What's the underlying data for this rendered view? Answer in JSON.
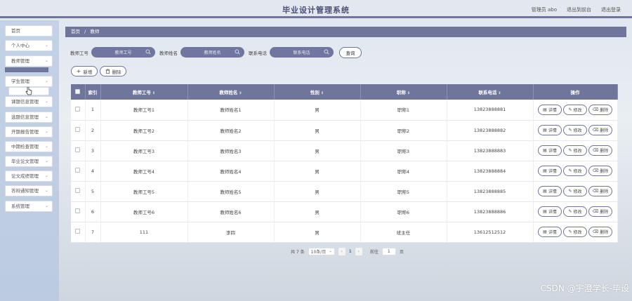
{
  "header": {
    "title": "毕业设计管理系统",
    "user_label": "管理员 abo",
    "front_link": "退出到前台",
    "logout_link": "退出登录"
  },
  "sidebar": {
    "items": [
      {
        "label": "首页",
        "has_arrow": false
      },
      {
        "label": "个人中心",
        "has_arrow": true
      },
      {
        "label": "教师管理",
        "has_arrow": true
      },
      {
        "label": "学生管理",
        "has_arrow": true
      },
      {
        "label": "课题信息管理",
        "has_arrow": true
      },
      {
        "label": "选题信息管理",
        "has_arrow": true
      },
      {
        "label": "开题报告管理",
        "has_arrow": true
      },
      {
        "label": "中期检查管理",
        "has_arrow": true
      },
      {
        "label": "毕业论文管理",
        "has_arrow": true
      },
      {
        "label": "论文成绩管理",
        "has_arrow": true
      },
      {
        "label": "答辩通知管理",
        "has_arrow": true
      },
      {
        "label": "系统管理",
        "has_arrow": true
      }
    ]
  },
  "breadcrumb": {
    "home": "首页",
    "sep": "/",
    "current": "教师"
  },
  "search": {
    "fields": [
      {
        "label": "教师工号",
        "placeholder": "教师工号"
      },
      {
        "label": "教师姓名",
        "placeholder": "教师姓名"
      },
      {
        "label": "联系电话",
        "placeholder": "联系电话"
      }
    ],
    "query_label": "查询"
  },
  "actions": {
    "add_label": "新增",
    "delete_label": "删除"
  },
  "table": {
    "headers": [
      "索引",
      "教师工号",
      "教师姓名",
      "性别",
      "职称",
      "联系电话",
      "操作"
    ],
    "rows": [
      {
        "index": "1",
        "job_no": "教师工号1",
        "name": "教师姓名1",
        "gender": "男",
        "title": "职称1",
        "phone": "13823888881"
      },
      {
        "index": "2",
        "job_no": "教师工号2",
        "name": "教师姓名2",
        "gender": "男",
        "title": "职称2",
        "phone": "13823888882"
      },
      {
        "index": "3",
        "job_no": "教师工号3",
        "name": "教师姓名3",
        "gender": "男",
        "title": "职称3",
        "phone": "13823888883"
      },
      {
        "index": "4",
        "job_no": "教师工号4",
        "name": "教师姓名4",
        "gender": "男",
        "title": "职称4",
        "phone": "13823888884"
      },
      {
        "index": "5",
        "job_no": "教师工号5",
        "name": "教师姓名5",
        "gender": "男",
        "title": "职称5",
        "phone": "13823888885"
      },
      {
        "index": "6",
        "job_no": "教师工号6",
        "name": "教师姓名6",
        "gender": "男",
        "title": "职称6",
        "phone": "13823888886"
      },
      {
        "index": "7",
        "job_no": "111",
        "name": "李四",
        "gender": "男",
        "title": "班主任",
        "phone": "13612512512"
      }
    ],
    "op_labels": {
      "detail": "详情",
      "edit": "修改",
      "delete": "删除"
    }
  },
  "pagination": {
    "total": "共 7 条",
    "page_size": "10条/页",
    "current_page": "1",
    "goto_label": "前往",
    "goto_value": "1",
    "page_suffix": "页"
  },
  "watermark": "CSDN @宇澄学长-毕设",
  "colors": {
    "accent": "#6f759b",
    "sidebar_bg": "#bccbe0"
  }
}
